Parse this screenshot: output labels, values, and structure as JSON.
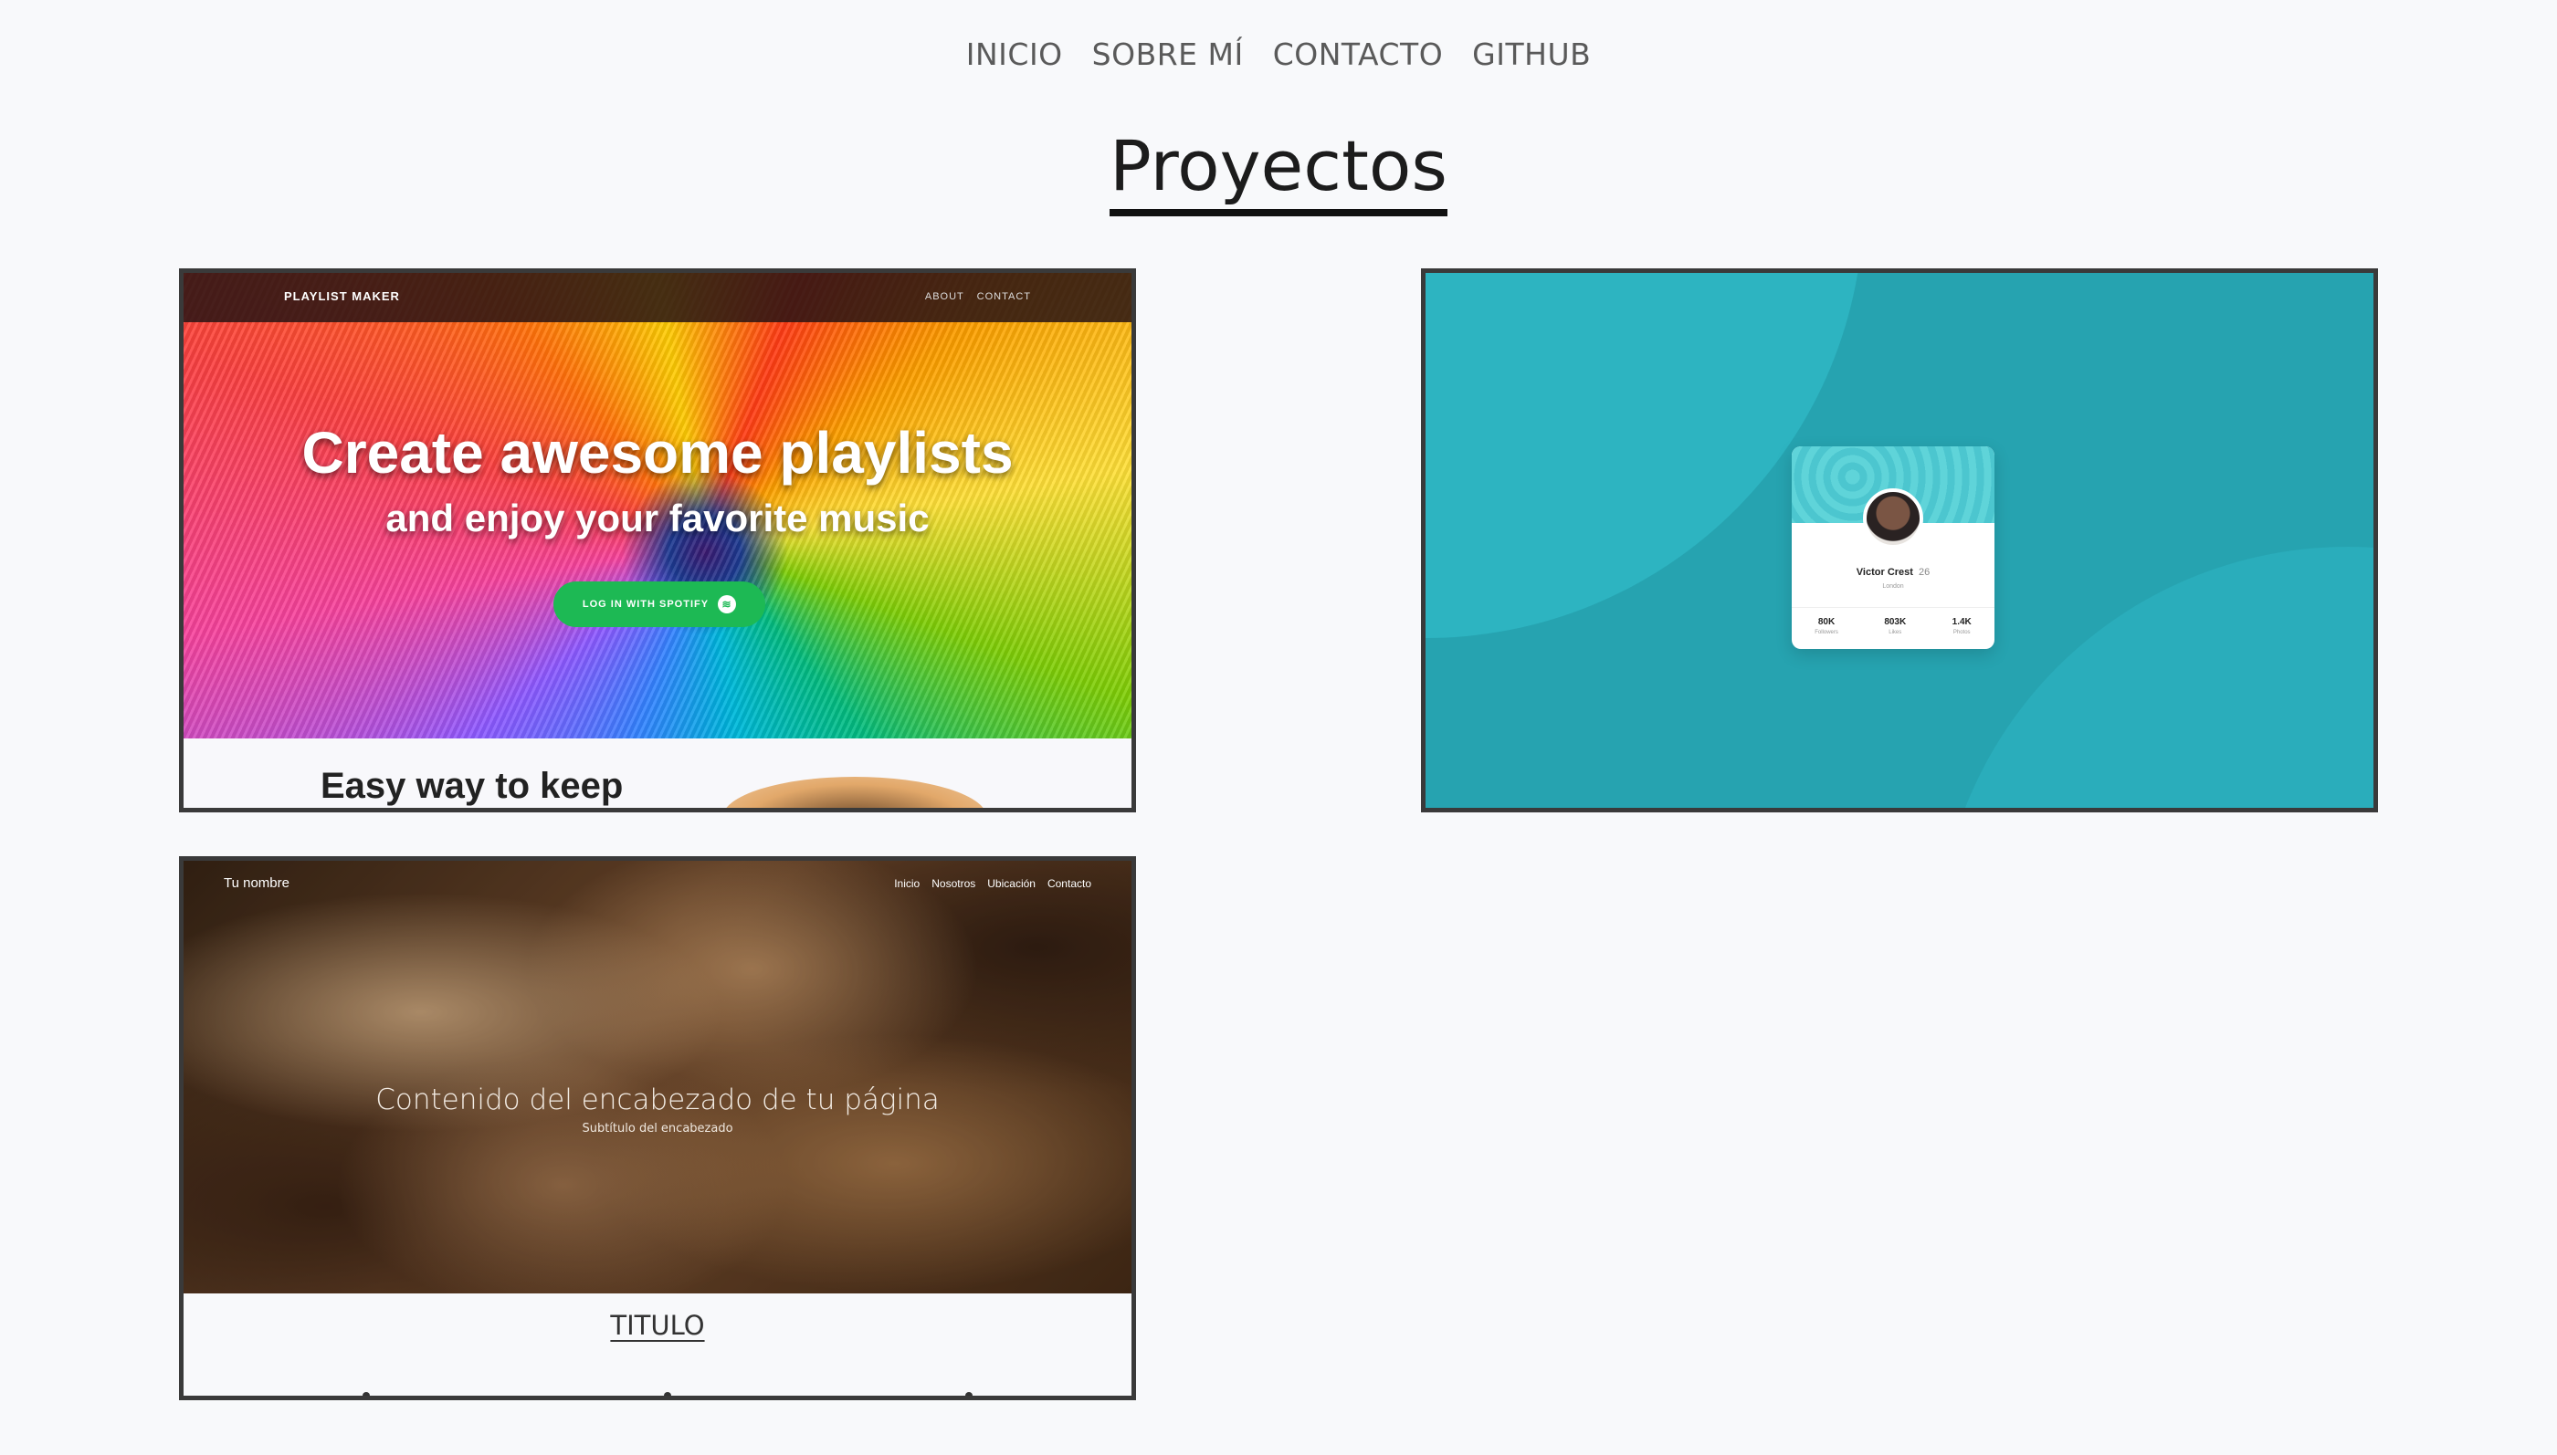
{
  "nav": {
    "items": [
      "INICIO",
      "SOBRE MÍ",
      "CONTACTO",
      "GITHUB"
    ]
  },
  "page_title": "Proyectos",
  "projects": [
    {
      "brand": "PLAYLIST MAKER",
      "links": [
        "ABOUT",
        "CONTACT"
      ],
      "headline": "Create awesome playlists",
      "subheadline": "and enjoy your favorite music",
      "button_label": "LOG IN WITH SPOTIFY",
      "section_heading": "Easy way to keep"
    },
    {
      "name": "Victor Crest",
      "age": "26",
      "location": "London",
      "stats": [
        {
          "value": "80K",
          "label": "Followers"
        },
        {
          "value": "803K",
          "label": "Likes"
        },
        {
          "value": "1.4K",
          "label": "Photos"
        }
      ]
    },
    {
      "brand": "Tu nombre",
      "links": [
        "Inicio",
        "Nosotros",
        "Ubicación",
        "Contacto"
      ],
      "header": "Contenido del encabezado de tu página",
      "subheader": "Subtítulo del encabezado",
      "section_title": "TITULO"
    }
  ],
  "colors": {
    "background": "#f8f9fb",
    "nav_text": "#5a5a5a",
    "card_border": "#3a3a3a",
    "spotify_green": "#1db954",
    "profile_bg": "#26a3b0"
  }
}
